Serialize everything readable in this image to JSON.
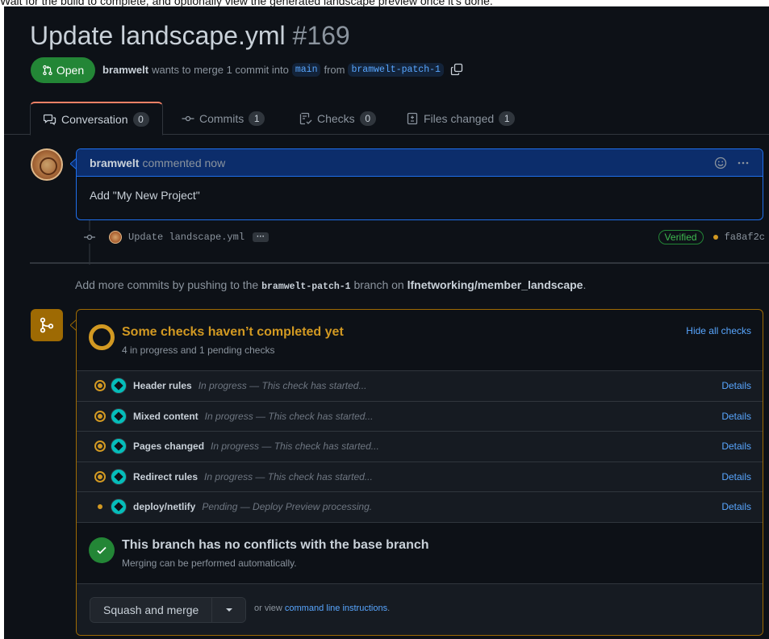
{
  "caption": "Wait for the build to complete, and optionally view the generated landscape preview once it's done.",
  "pr": {
    "title": "Update landscape.yml",
    "number": "#169",
    "state": "Open",
    "author": "bramwelt",
    "merge_text": "wants to merge 1 commit into",
    "base_branch": "main",
    "from_text": "from",
    "head_branch": "bramwelt-patch-1"
  },
  "tabs": [
    {
      "label": "Conversation",
      "count": "0",
      "icon": "comment-discussion-icon"
    },
    {
      "label": "Commits",
      "count": "1",
      "icon": "git-commit-icon"
    },
    {
      "label": "Checks",
      "count": "0",
      "icon": "checklist-icon"
    },
    {
      "label": "Files changed",
      "count": "1",
      "icon": "file-diff-icon"
    }
  ],
  "comment": {
    "author": "bramwelt",
    "time": "commented now",
    "body": "Add \"My New Project\""
  },
  "commit": {
    "message": "Update landscape.yml",
    "verified": "Verified",
    "sha": "fa8af2c"
  },
  "hint": {
    "prefix": "Add more commits by pushing to the",
    "branch": "bramwelt-patch-1",
    "middle": "branch on",
    "repo": "lfnetworking/member_landscape",
    "suffix": "."
  },
  "checks": {
    "title": "Some checks haven’t completed yet",
    "subtitle": "4 in progress and 1 pending checks",
    "hide_label": "Hide all checks",
    "items": [
      {
        "name": "Header rules",
        "desc": "In progress — This check has started...",
        "details": "Details",
        "status": "in-progress"
      },
      {
        "name": "Mixed content",
        "desc": "In progress — This check has started...",
        "details": "Details",
        "status": "in-progress"
      },
      {
        "name": "Pages changed",
        "desc": "In progress — This check has started...",
        "details": "Details",
        "status": "in-progress"
      },
      {
        "name": "Redirect rules",
        "desc": "In progress — This check has started...",
        "details": "Details",
        "status": "in-progress"
      },
      {
        "name": "deploy/netlify",
        "desc": "Pending — Deploy Preview processing.",
        "details": "Details",
        "status": "pending"
      }
    ]
  },
  "conflicts": {
    "title": "This branch has no conflicts with the base branch",
    "subtitle": "Merging can be performed automatically."
  },
  "merge": {
    "button": "Squash and merge",
    "or_view": "or view",
    "cli_link": "command line instructions",
    "cli_suffix": "."
  },
  "colors": {
    "background": "#0d1117",
    "open_green": "#238636",
    "pending_yellow": "#d29922",
    "link_blue": "#58a6ff",
    "comment_border": "#1f6feb"
  }
}
